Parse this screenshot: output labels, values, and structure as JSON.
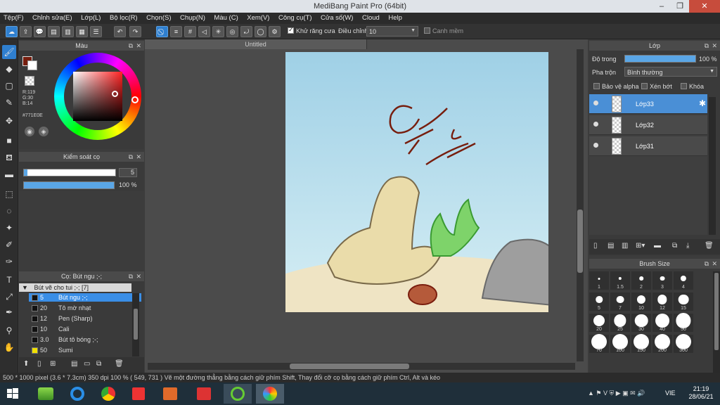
{
  "window": {
    "title": "MediBang Paint Pro (64bit)",
    "minimize": "–",
    "restore": "❐",
    "close": "✕"
  },
  "menu": [
    "Tệp(F)",
    "Chỉnh sửa(E)",
    "Lớp(L)",
    "Bộ lọc(R)",
    "Chọn(S)",
    "Chụp(N)",
    "Màu (C)",
    "Xem(V)",
    "Công cụ(T)",
    "Cửa số(W)",
    "Cloud",
    "Help"
  ],
  "toolbar": {
    "antialias_label": "Khử răng cưa",
    "correction_label": "Điều chỉnh",
    "correction_value": "10",
    "snap_label": "Canh mềm"
  },
  "color_panel": {
    "title": "Màu",
    "r": "R:119",
    "g": "G:30",
    "b": "B:14",
    "hex": "#771E0E",
    "fg_color": "#771E0E"
  },
  "brush_control": {
    "title": "Kiểm soát cọ",
    "size_value": "5",
    "opacity_value": "100 %",
    "size_fraction": 0.04,
    "opacity_fraction": 1.0
  },
  "brush_panel": {
    "title": "Cọ: Bút ngu ;-;",
    "group": "Bút vẽ cho tui ;-; [7]",
    "items": [
      {
        "size": "5",
        "name": "Bút ngu ;-;",
        "selected": true,
        "swatch": "#111111"
      },
      {
        "size": "20",
        "name": "Tô mờ nhạt",
        "selected": false,
        "swatch": "#111111"
      },
      {
        "size": "12",
        "name": "Pen (Sharp)",
        "selected": false,
        "swatch": "#111111"
      },
      {
        "size": "10",
        "name": "Cali",
        "selected": false,
        "swatch": "#111111"
      },
      {
        "size": "3.0",
        "name": "Bút tô bóng ;-;",
        "selected": false,
        "swatch": "#111111"
      },
      {
        "size": "50",
        "name": "Sumi",
        "selected": false,
        "swatch": "#f1e000"
      }
    ]
  },
  "document": {
    "tab": "Untitled"
  },
  "layer_panel": {
    "title": "Lớp",
    "opacity_label": "Độ trong",
    "opacity_value": "100 %",
    "opacity_fraction": 1.0,
    "blend_label": "Pha trộn",
    "blend_value": "Bình thường",
    "protect_alpha": "Bảo vệ alpha",
    "clipping": "Xén bớt",
    "lock": "Khóa",
    "layers": [
      {
        "name": "Lớp33",
        "selected": true
      },
      {
        "name": "Lớp32",
        "selected": false
      },
      {
        "name": "Lớp31",
        "selected": false
      }
    ]
  },
  "brush_size_panel": {
    "title": "Brush Size",
    "sizes": [
      "1",
      "1.5",
      "2",
      "3",
      "4",
      "5",
      "7",
      "10",
      "12",
      "15",
      "20",
      "25",
      "30",
      "40",
      "50",
      "70",
      "100",
      "150",
      "200",
      "300"
    ]
  },
  "status": {
    "text": "500 * 1000 pixel   (3.6 * 7.3cm)   350 dpi   100 %   ( 549, 731 )   Vẽ một đường thẳng bằng cách giữ phím Shift, Thay đổi cỡ cọ bằng cách giữ phím Ctrl, Alt và kéo"
  },
  "taskbar": {
    "lang": "VIE",
    "time": "21:19",
    "date": "28/06/21"
  },
  "colors": {
    "accent": "#2f7fcf",
    "sky": "#bcdce8",
    "sand": "#efe4c4"
  }
}
